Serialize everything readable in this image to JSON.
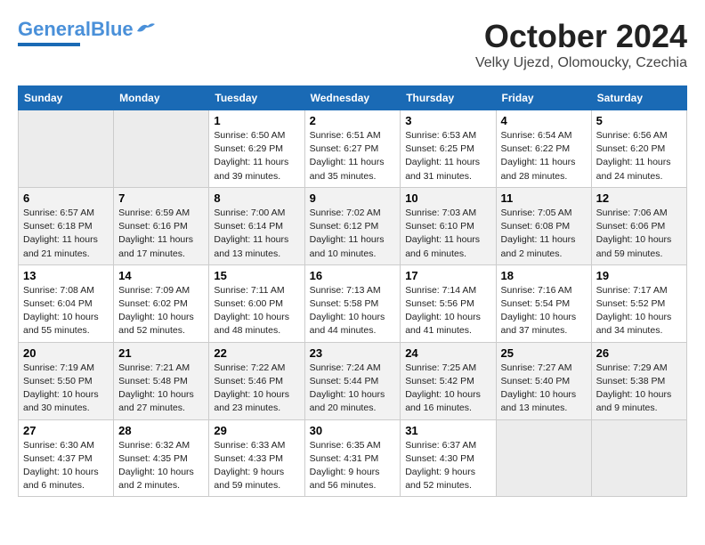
{
  "header": {
    "logo_general": "General",
    "logo_blue": "Blue",
    "month": "October 2024",
    "location": "Velky Ujezd, Olomoucky, Czechia"
  },
  "days_of_week": [
    "Sunday",
    "Monday",
    "Tuesday",
    "Wednesday",
    "Thursday",
    "Friday",
    "Saturday"
  ],
  "weeks": [
    [
      {
        "day": null
      },
      {
        "day": null
      },
      {
        "day": "1",
        "sunrise": "6:50 AM",
        "sunset": "6:29 PM",
        "daylight": "11 hours and 39 minutes."
      },
      {
        "day": "2",
        "sunrise": "6:51 AM",
        "sunset": "6:27 PM",
        "daylight": "11 hours and 35 minutes."
      },
      {
        "day": "3",
        "sunrise": "6:53 AM",
        "sunset": "6:25 PM",
        "daylight": "11 hours and 31 minutes."
      },
      {
        "day": "4",
        "sunrise": "6:54 AM",
        "sunset": "6:22 PM",
        "daylight": "11 hours and 28 minutes."
      },
      {
        "day": "5",
        "sunrise": "6:56 AM",
        "sunset": "6:20 PM",
        "daylight": "11 hours and 24 minutes."
      }
    ],
    [
      {
        "day": "6",
        "sunrise": "6:57 AM",
        "sunset": "6:18 PM",
        "daylight": "11 hours and 21 minutes."
      },
      {
        "day": "7",
        "sunrise": "6:59 AM",
        "sunset": "6:16 PM",
        "daylight": "11 hours and 17 minutes."
      },
      {
        "day": "8",
        "sunrise": "7:00 AM",
        "sunset": "6:14 PM",
        "daylight": "11 hours and 13 minutes."
      },
      {
        "day": "9",
        "sunrise": "7:02 AM",
        "sunset": "6:12 PM",
        "daylight": "11 hours and 10 minutes."
      },
      {
        "day": "10",
        "sunrise": "7:03 AM",
        "sunset": "6:10 PM",
        "daylight": "11 hours and 6 minutes."
      },
      {
        "day": "11",
        "sunrise": "7:05 AM",
        "sunset": "6:08 PM",
        "daylight": "11 hours and 2 minutes."
      },
      {
        "day": "12",
        "sunrise": "7:06 AM",
        "sunset": "6:06 PM",
        "daylight": "10 hours and 59 minutes."
      }
    ],
    [
      {
        "day": "13",
        "sunrise": "7:08 AM",
        "sunset": "6:04 PM",
        "daylight": "10 hours and 55 minutes."
      },
      {
        "day": "14",
        "sunrise": "7:09 AM",
        "sunset": "6:02 PM",
        "daylight": "10 hours and 52 minutes."
      },
      {
        "day": "15",
        "sunrise": "7:11 AM",
        "sunset": "6:00 PM",
        "daylight": "10 hours and 48 minutes."
      },
      {
        "day": "16",
        "sunrise": "7:13 AM",
        "sunset": "5:58 PM",
        "daylight": "10 hours and 44 minutes."
      },
      {
        "day": "17",
        "sunrise": "7:14 AM",
        "sunset": "5:56 PM",
        "daylight": "10 hours and 41 minutes."
      },
      {
        "day": "18",
        "sunrise": "7:16 AM",
        "sunset": "5:54 PM",
        "daylight": "10 hours and 37 minutes."
      },
      {
        "day": "19",
        "sunrise": "7:17 AM",
        "sunset": "5:52 PM",
        "daylight": "10 hours and 34 minutes."
      }
    ],
    [
      {
        "day": "20",
        "sunrise": "7:19 AM",
        "sunset": "5:50 PM",
        "daylight": "10 hours and 30 minutes."
      },
      {
        "day": "21",
        "sunrise": "7:21 AM",
        "sunset": "5:48 PM",
        "daylight": "10 hours and 27 minutes."
      },
      {
        "day": "22",
        "sunrise": "7:22 AM",
        "sunset": "5:46 PM",
        "daylight": "10 hours and 23 minutes."
      },
      {
        "day": "23",
        "sunrise": "7:24 AM",
        "sunset": "5:44 PM",
        "daylight": "10 hours and 20 minutes."
      },
      {
        "day": "24",
        "sunrise": "7:25 AM",
        "sunset": "5:42 PM",
        "daylight": "10 hours and 16 minutes."
      },
      {
        "day": "25",
        "sunrise": "7:27 AM",
        "sunset": "5:40 PM",
        "daylight": "10 hours and 13 minutes."
      },
      {
        "day": "26",
        "sunrise": "7:29 AM",
        "sunset": "5:38 PM",
        "daylight": "10 hours and 9 minutes."
      }
    ],
    [
      {
        "day": "27",
        "sunrise": "6:30 AM",
        "sunset": "4:37 PM",
        "daylight": "10 hours and 6 minutes."
      },
      {
        "day": "28",
        "sunrise": "6:32 AM",
        "sunset": "4:35 PM",
        "daylight": "10 hours and 2 minutes."
      },
      {
        "day": "29",
        "sunrise": "6:33 AM",
        "sunset": "4:33 PM",
        "daylight": "9 hours and 59 minutes."
      },
      {
        "day": "30",
        "sunrise": "6:35 AM",
        "sunset": "4:31 PM",
        "daylight": "9 hours and 56 minutes."
      },
      {
        "day": "31",
        "sunrise": "6:37 AM",
        "sunset": "4:30 PM",
        "daylight": "9 hours and 52 minutes."
      },
      {
        "day": null
      },
      {
        "day": null
      }
    ]
  ]
}
